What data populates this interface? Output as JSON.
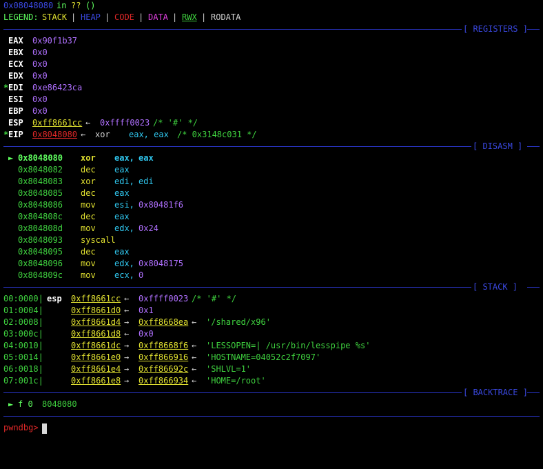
{
  "colors": {
    "background": "#000000",
    "stack": "#e0e030",
    "heap": "#3a48e0",
    "code": "#e02828",
    "data": "#e040e0",
    "rwx": "#3fd23f",
    "rodata": "#d0d0d0",
    "separator": "#2a36c8"
  },
  "header": {
    "address": "0x08048080",
    "in": "in",
    "func": "??",
    "parens": "()"
  },
  "legend": {
    "label": "LEGEND:",
    "stack": "STACK",
    "heap": "HEAP",
    "code": "CODE",
    "data": "DATA",
    "rwx": "RWX",
    "rodata": "RODATA",
    "sep": "|"
  },
  "sections": {
    "registers": "[ REGISTERS ]",
    "disasm": "[ DISASM ]",
    "stack": "[ STACK ]",
    "backtrace": "[ BACKTRACE ]"
  },
  "registers": [
    {
      "mark": " ",
      "name": "EAX",
      "value": "0x90f1b37"
    },
    {
      "mark": " ",
      "name": "EBX",
      "value": "0x0"
    },
    {
      "mark": " ",
      "name": "ECX",
      "value": "0x0"
    },
    {
      "mark": " ",
      "name": "EDX",
      "value": "0x0"
    },
    {
      "mark": "*",
      "name": "EDI",
      "value": "0xe86423ca"
    },
    {
      "mark": " ",
      "name": "ESI",
      "value": "0x0"
    },
    {
      "mark": " ",
      "name": "EBP",
      "value": "0x0"
    },
    {
      "mark": " ",
      "name": "ESP",
      "value": "0xff8661cc",
      "arrow": "←",
      "deref": "0xffff0023",
      "comment": "/* '#' */"
    },
    {
      "mark": "*",
      "name": "EIP",
      "value": "0x8048080",
      "arrow": "←",
      "mnemonic": "xor",
      "operands": "eax, eax",
      "comment": "/* 0x3148c031 */"
    }
  ],
  "disasm": [
    {
      "current": true,
      "marker": "►",
      "addr": "0x8048080",
      "mnemonic": "xor",
      "op1": "eax,",
      "op2": "eax"
    },
    {
      "addr": "0x8048082",
      "mnemonic": "dec",
      "op1": "eax",
      "op2": ""
    },
    {
      "addr": "0x8048083",
      "mnemonic": "xor",
      "op1": "edi,",
      "op2": "edi"
    },
    {
      "addr": "0x8048085",
      "mnemonic": "dec",
      "op1": "eax",
      "op2": ""
    },
    {
      "addr": "0x8048086",
      "mnemonic": "mov",
      "op1": "esi,",
      "op2": "0x80481f6"
    },
    {
      "addr": "0x804808c",
      "mnemonic": "dec",
      "op1": "eax",
      "op2": ""
    },
    {
      "addr": "0x804808d",
      "mnemonic": "mov",
      "op1": "edx,",
      "op2": "0x24"
    },
    {
      "addr": "0x8048093",
      "mnemonic": "syscall",
      "op1": "",
      "op2": ""
    },
    {
      "addr": "0x8048095",
      "mnemonic": "dec",
      "op1": "eax",
      "op2": ""
    },
    {
      "addr": "0x8048096",
      "mnemonic": "mov",
      "op1": "edx,",
      "op2": "0x8048175"
    },
    {
      "addr": "0x804809c",
      "mnemonic": "mov",
      "op1": "ecx,",
      "op2": "0"
    }
  ],
  "stack": [
    {
      "idx": "00:0000|",
      "reg": "esp",
      "addr": "0xff8661cc",
      "a1": "←",
      "v1": "0xffff0023",
      "v1_yellow": false,
      "a2": "",
      "v2": "/* '#' */"
    },
    {
      "idx": "01:0004|",
      "reg": "",
      "addr": "0xff8661d0",
      "a1": "←",
      "v1": "0x1",
      "v1_yellow": false,
      "a2": "",
      "v2": ""
    },
    {
      "idx": "02:0008|",
      "reg": "",
      "addr": "0xff8661d4",
      "a1": "→",
      "v1": "0xff8668ea",
      "v1_yellow": true,
      "a2": "←",
      "v2": "'/shared/x96'"
    },
    {
      "idx": "03:000c|",
      "reg": "",
      "addr": "0xff8661d8",
      "a1": "←",
      "v1": "0x0",
      "v1_yellow": false,
      "a2": "",
      "v2": ""
    },
    {
      "idx": "04:0010|",
      "reg": "",
      "addr": "0xff8661dc",
      "a1": "→",
      "v1": "0xff8668f6",
      "v1_yellow": true,
      "a2": "←",
      "v2": "'LESSOPEN=| /usr/bin/lesspipe %s'"
    },
    {
      "idx": "05:0014|",
      "reg": "",
      "addr": "0xff8661e0",
      "a1": "→",
      "v1": "0xff866916",
      "v1_yellow": true,
      "a2": "←",
      "v2": "'HOSTNAME=04052c2f7097'"
    },
    {
      "idx": "06:0018|",
      "reg": "",
      "addr": "0xff8661e4",
      "a1": "→",
      "v1": "0xff86692c",
      "v1_yellow": true,
      "a2": "←",
      "v2": "'SHLVL=1'"
    },
    {
      "idx": "07:001c|",
      "reg": "",
      "addr": "0xff8661e8",
      "a1": "→",
      "v1": "0xff866934",
      "v1_yellow": true,
      "a2": "←",
      "v2": "'HOME=/root'"
    }
  ],
  "backtrace": [
    {
      "marker": "►",
      "frame": "f 0",
      "addr": "8048080"
    }
  ],
  "prompt": "pwndbg>"
}
